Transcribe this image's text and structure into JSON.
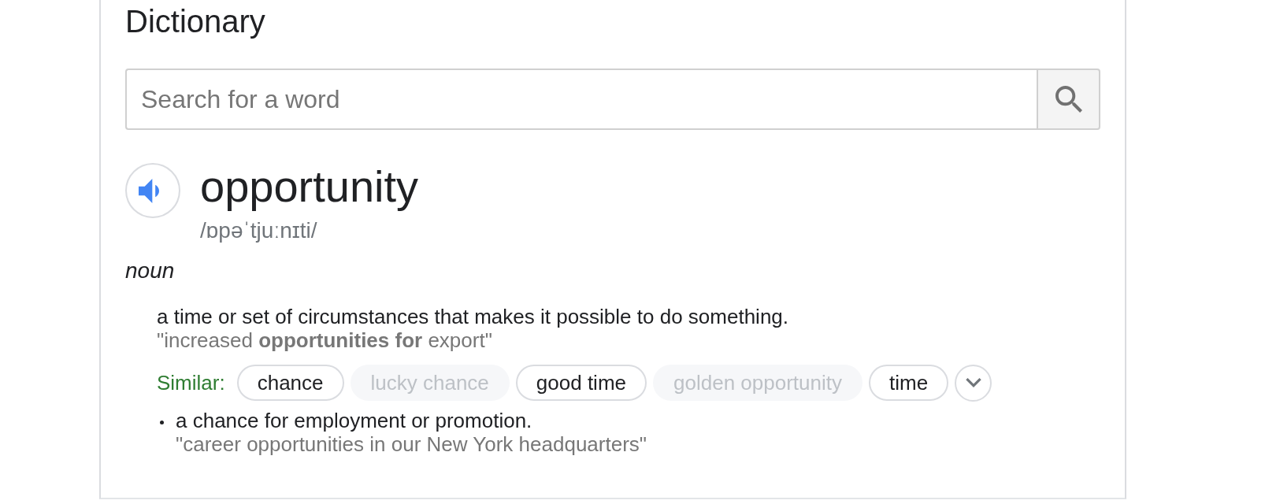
{
  "panel": {
    "title": "Dictionary"
  },
  "search": {
    "placeholder": "Search for a word"
  },
  "entry": {
    "word": "opportunity",
    "phonetic": "/ɒpəˈtjuːnɪti/",
    "part_of_speech": "noun",
    "senses": [
      {
        "definition": "a time or set of circumstances that makes it possible to do something.",
        "example": "\"increased **opportunities for** export\"",
        "similar_label": "Similar:",
        "similar": [
          {
            "text": "chance",
            "disabled": false
          },
          {
            "text": "lucky chance",
            "disabled": true
          },
          {
            "text": "good time",
            "disabled": false
          },
          {
            "text": "golden opportunity",
            "disabled": true
          },
          {
            "text": "time",
            "disabled": false
          }
        ],
        "children": [
          {
            "definition": "a chance for employment or promotion.",
            "example": "\"career opportunities in our New York headquarters\""
          }
        ]
      }
    ]
  }
}
